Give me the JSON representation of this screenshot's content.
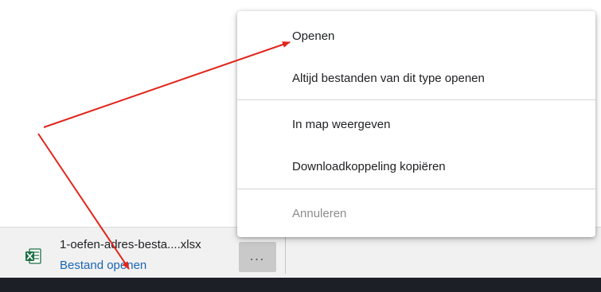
{
  "download_bar": {
    "item": {
      "file_name": "1-oefen-adres-besta....xlsx",
      "action_label": "Bestand openen",
      "file_type_icon": "excel-file-icon"
    },
    "more_button_label": "...",
    "more_button_icon": "more-horizontal-icon"
  },
  "context_menu": {
    "open": "Openen",
    "always_open": "Altijd bestanden van dit type openen",
    "show_in_folder": "In map weergeven",
    "copy_link": "Downloadkoppeling kopiëren",
    "cancel": "Annuleren"
  },
  "annotation": {
    "arrow_color": "#e1251b"
  },
  "colors": {
    "link_blue": "#1a66b4",
    "download_bar_bg": "#f1f1f1",
    "taskbar_bg": "#1c2026",
    "excel_green": "#1e7145"
  }
}
